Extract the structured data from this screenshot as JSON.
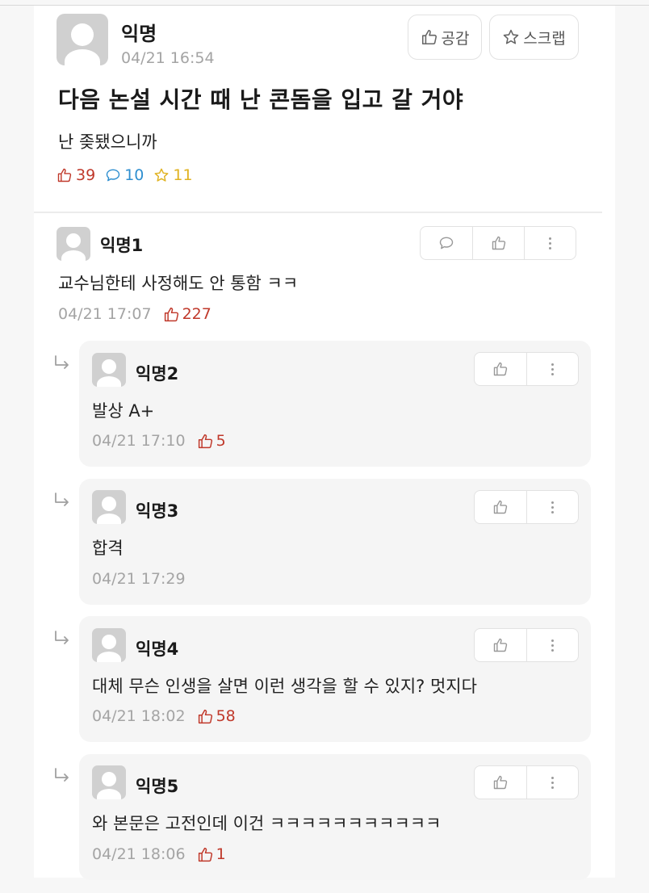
{
  "post": {
    "author": "익명",
    "time": "04/21 16:54",
    "like_button": "공감",
    "scrap_button": "스크랩",
    "title": "다음 논설 시간 때 난 콘돔을 입고 갈 거야",
    "body": "난 좆됐으니까",
    "likes": "39",
    "comments": "10",
    "scraps": "11"
  },
  "comment": {
    "author": "익명1",
    "text": "교수님한테 사정해도 안 통함 ㅋㅋ",
    "time": "04/21 17:07",
    "likes": "227"
  },
  "replies": [
    {
      "author": "익명2",
      "text": "발상 A+",
      "time": "04/21 17:10",
      "likes": "5"
    },
    {
      "author": "익명3",
      "text": "합격",
      "time": "04/21 17:29",
      "likes": ""
    },
    {
      "author": "익명4",
      "text": "대체 무슨 인생을 살면 이런 생각을 할 수 있지? 멋지다",
      "time": "04/21 18:02",
      "likes": "58"
    },
    {
      "author": "익명5",
      "text": "와 본문은 고전인데 이건 ㅋㅋㅋㅋㅋㅋㅋㅋㅋㅋㅋ",
      "time": "04/21 18:06",
      "likes": "1"
    }
  ],
  "colors": {
    "like": "#c0392b",
    "comment": "#2f8fd0",
    "scrap": "#e0b220",
    "meta_gray": "#a4a4a4"
  },
  "icons": [
    "thumbs-up-icon",
    "star-icon",
    "comment-bubble-icon",
    "more-dots-icon",
    "reply-arrow-icon",
    "avatar-icon"
  ]
}
